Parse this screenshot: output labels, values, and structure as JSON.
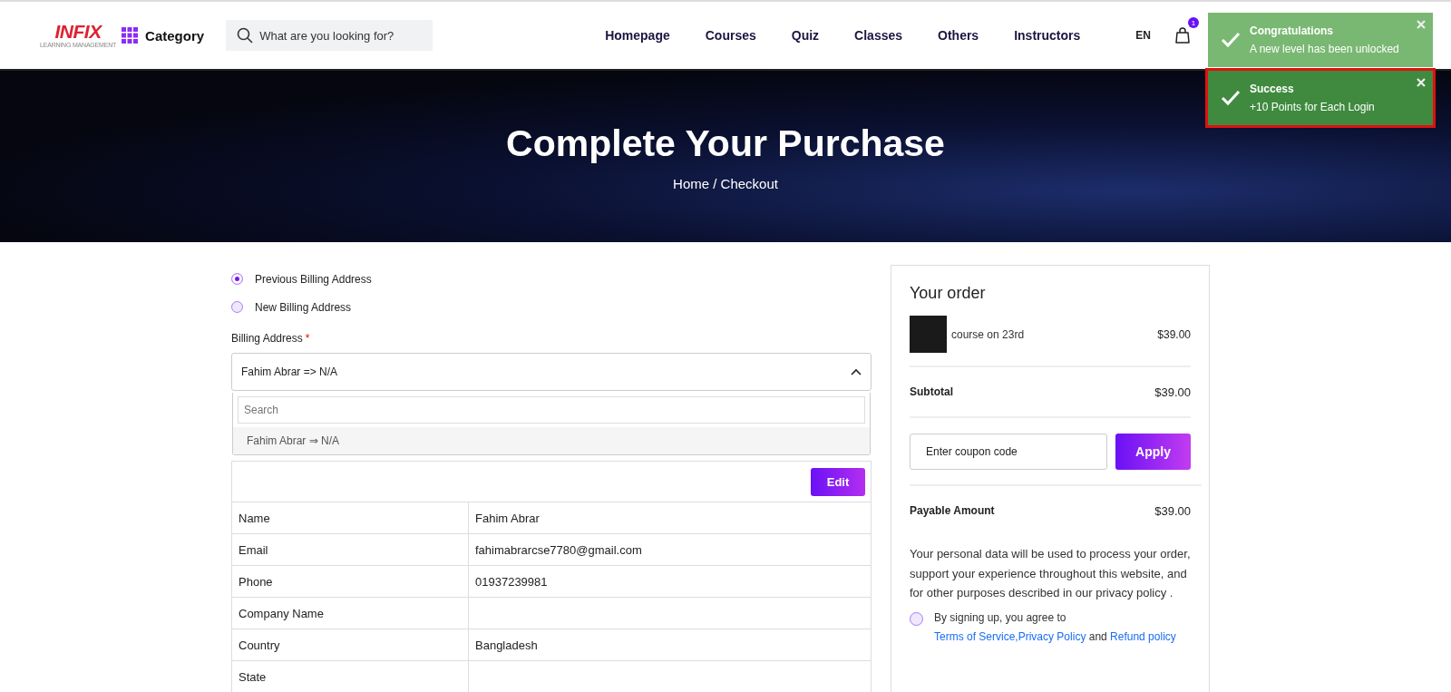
{
  "header": {
    "logo": {
      "name": "INFIX",
      "tagline": "LEARNING MANAGEMENT"
    },
    "category": "Category",
    "search": {
      "placeholder": "What are you looking for?"
    },
    "nav": [
      "Homepage",
      "Courses",
      "Quiz",
      "Classes",
      "Others",
      "Instructors"
    ],
    "language": "EN",
    "cart_count": "1"
  },
  "toasts": [
    {
      "title": "Congratulations",
      "message": "A new level has been unlocked",
      "color": "#79b872",
      "highlighted": false
    },
    {
      "title": "Success",
      "message": "+10 Points for Each Login",
      "color": "#3f8a3f",
      "highlighted": true
    }
  ],
  "hero": {
    "title": "Complete Your Purchase",
    "breadcrumb": "Home / Checkout"
  },
  "billing": {
    "options": [
      {
        "label": "Previous Billing Address",
        "selected": true
      },
      {
        "label": "New Billing Address",
        "selected": false
      }
    ],
    "address_label": "Billing Address",
    "required_mark": "*",
    "select": {
      "value": "Fahim Abrar => N/A",
      "expanded": true,
      "search_placeholder": "Search",
      "options": [
        "Fahim Abrar ⇒ N/A"
      ]
    },
    "edit_button": "Edit",
    "details": [
      {
        "label": "Name",
        "value": "Fahim Abrar"
      },
      {
        "label": "Email",
        "value": "fahimabrarcse7780@gmail.com"
      },
      {
        "label": "Phone",
        "value": "01937239981"
      },
      {
        "label": "Company Name"
      },
      {
        "label": "Country",
        "value": "Bangladesh"
      },
      {
        "label": "State"
      }
    ]
  },
  "order": {
    "title": "Your order",
    "items": [
      {
        "name": "course on 23rd",
        "price": "$39.00"
      }
    ],
    "subtotal": {
      "label": "Subtotal",
      "value": "$39.00"
    },
    "coupon": {
      "placeholder": "Enter coupon code",
      "button": "Apply"
    },
    "payable": {
      "label": "Payable Amount",
      "value": "$39.00"
    },
    "privacy_text": "Your personal data will be used to process your order, support your experience throughout this website, and for other purposes described in our privacy policy .",
    "agree": {
      "checked": false,
      "parts": [
        {
          "text": "By signing up, you agree to ",
          "link": false
        },
        {
          "text": "Terms of Service",
          "link": true
        },
        {
          "text": ",Privacy Policy",
          "link": true
        },
        {
          "text": " and ",
          "link": false
        },
        {
          "text": "Refund policy",
          "link": true
        }
      ]
    }
  }
}
